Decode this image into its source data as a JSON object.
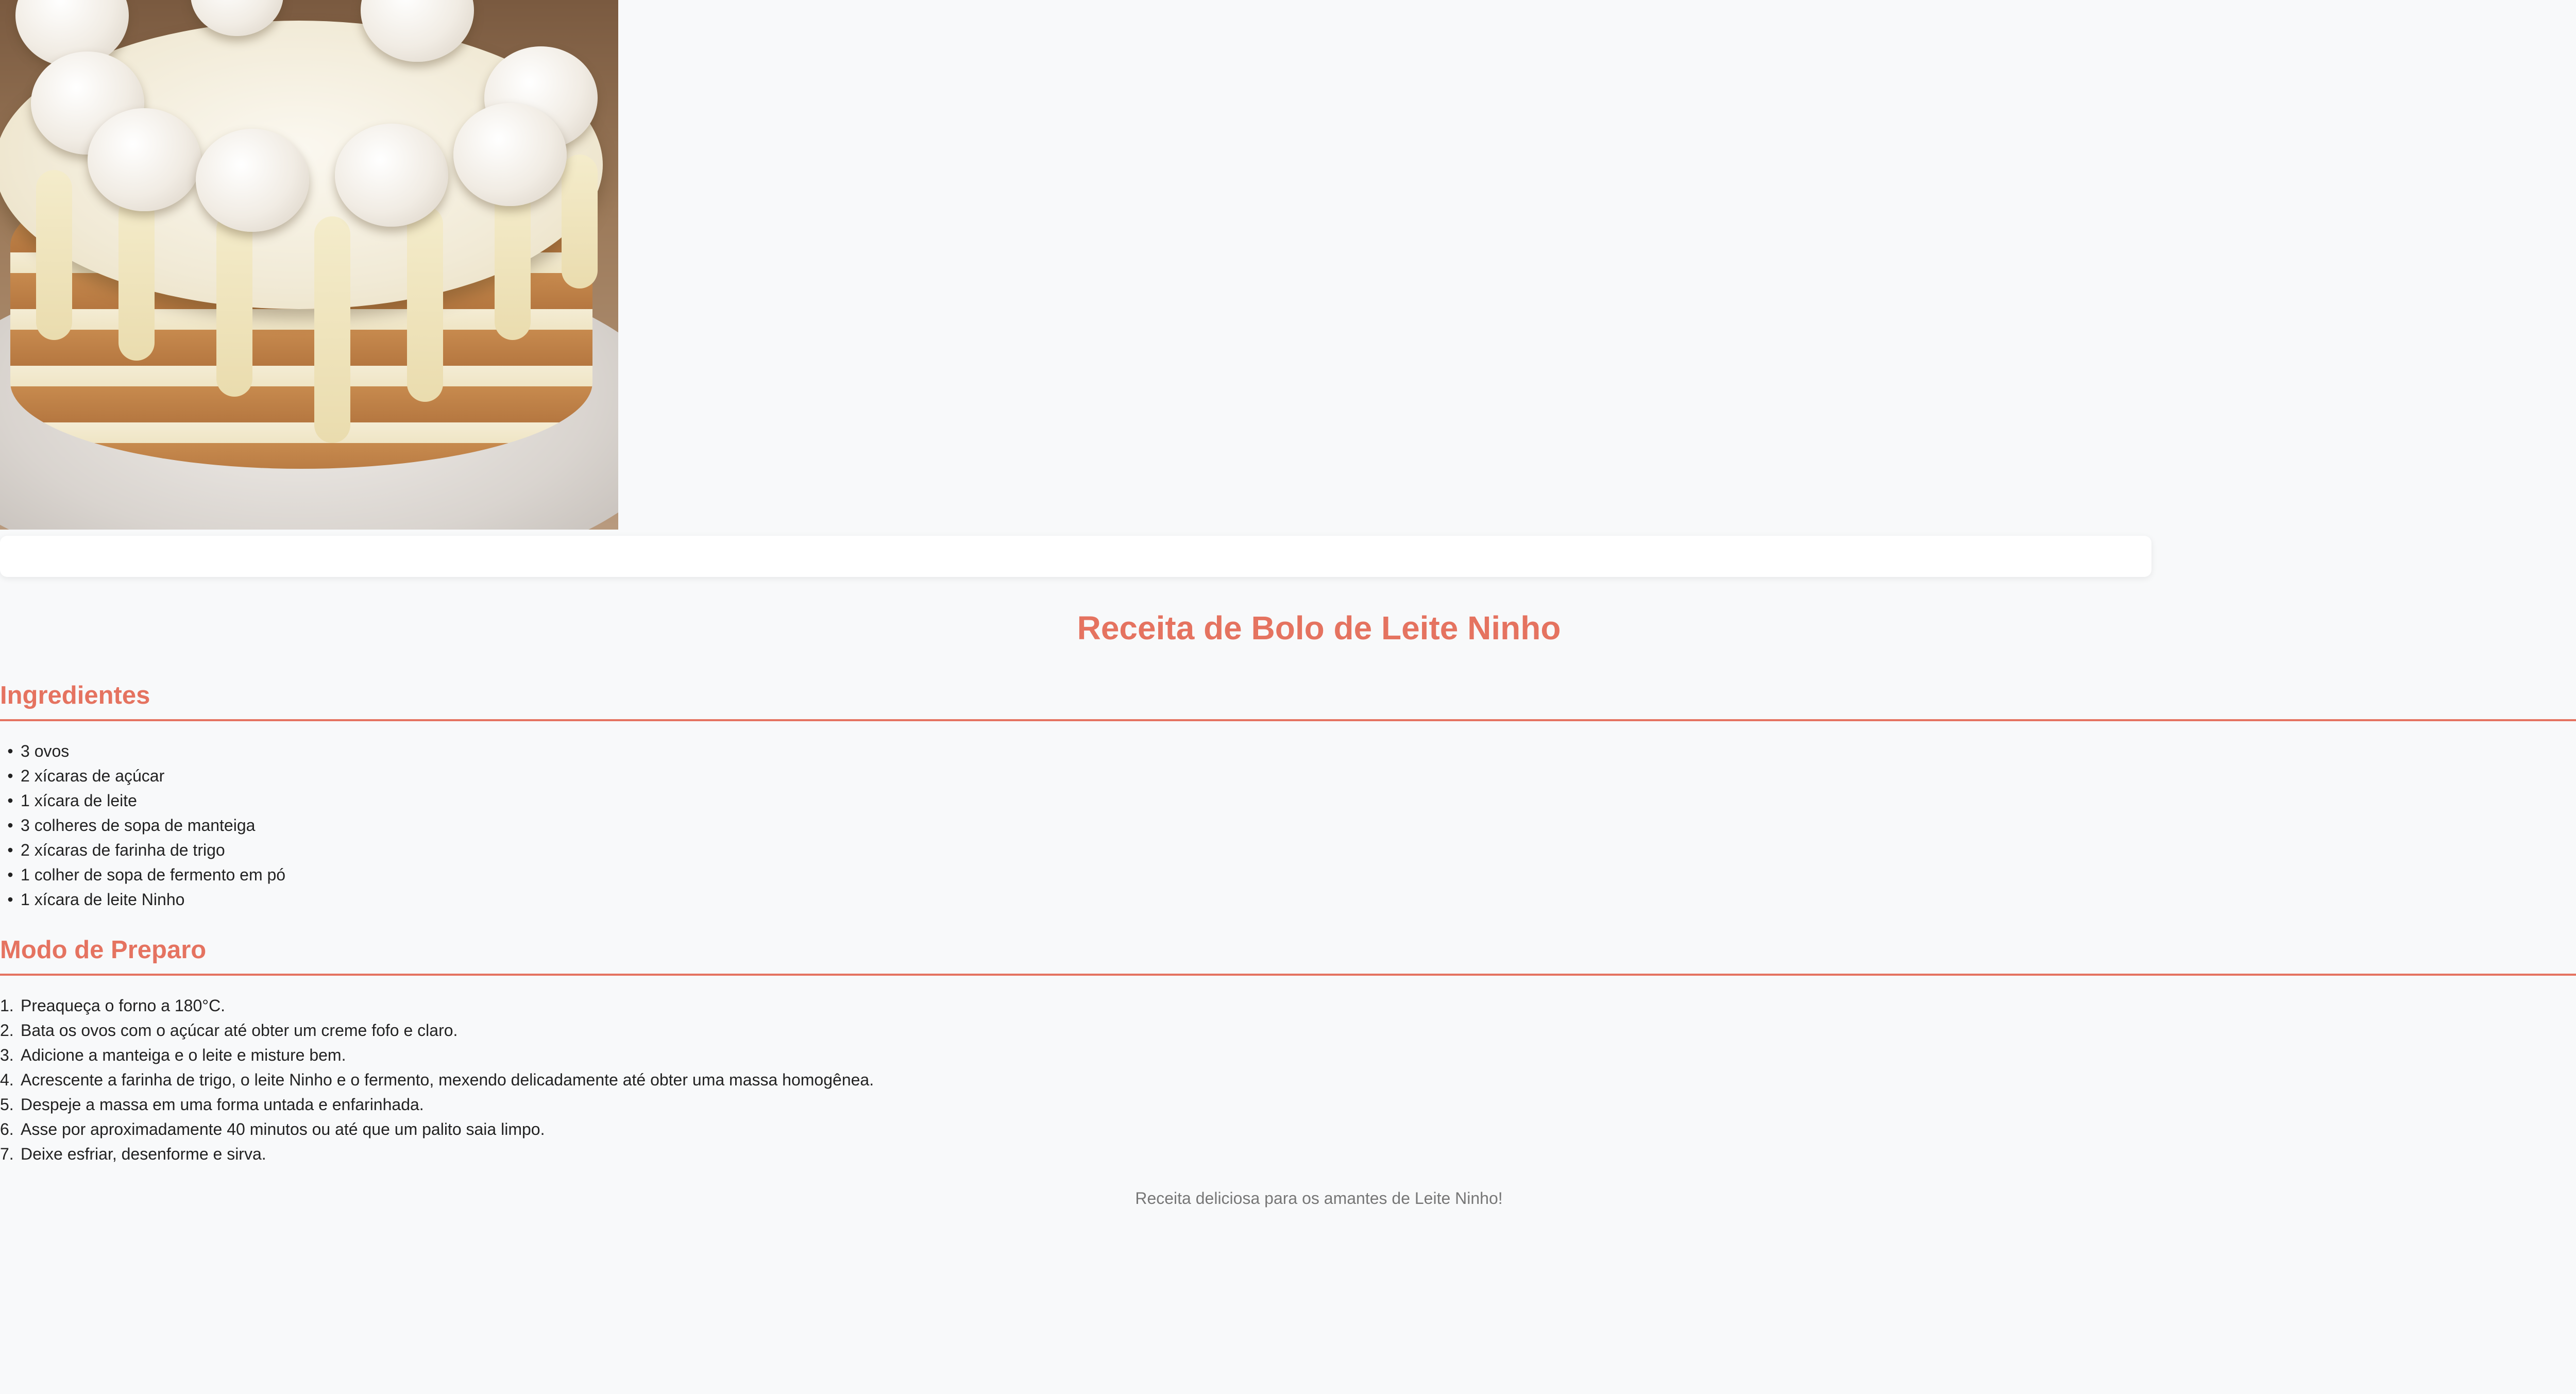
{
  "hero": {
    "image_alt": "Bolo de Leite Ninho"
  },
  "recipe": {
    "title": "Receita de Bolo de Leite Ninho",
    "ingredients_heading": "Ingredientes",
    "ingredients": [
      "3 ovos",
      "2 xícaras de açúcar",
      "1 xícara de leite",
      "3 colheres de sopa de manteiga",
      "2 xícaras de farinha de trigo",
      "1 colher de sopa de fermento em pó",
      "1 xícara de leite Ninho"
    ],
    "steps_heading": "Modo de Preparo",
    "steps": [
      "Preaqueça o forno a 180°C.",
      "Bata os ovos com o açúcar até obter um creme fofo e claro.",
      "Adicione a manteiga e o leite e misture bem.",
      "Acrescente a farinha de trigo, o leite Ninho e o fermento, mexendo delicadamente até obter uma massa homogênea.",
      "Despeje a massa em uma forma untada e enfarinhada.",
      "Asse por aproximadamente 40 minutos ou até que um palito saia limpo.",
      "Deixe esfriar, desenforme e sirva."
    ],
    "step_numbers": [
      "1.",
      "2.",
      "3.",
      "4.",
      "5.",
      "6.",
      "7."
    ],
    "footer": "Receita deliciosa para os amantes de Leite Ninho!"
  },
  "floating": {
    "assistant_icon": "openai-icon",
    "brain_icon": "brain-icon"
  },
  "colors": {
    "accent": "#e57360",
    "background": "#f8f9fa",
    "footer_text": "#777777"
  }
}
